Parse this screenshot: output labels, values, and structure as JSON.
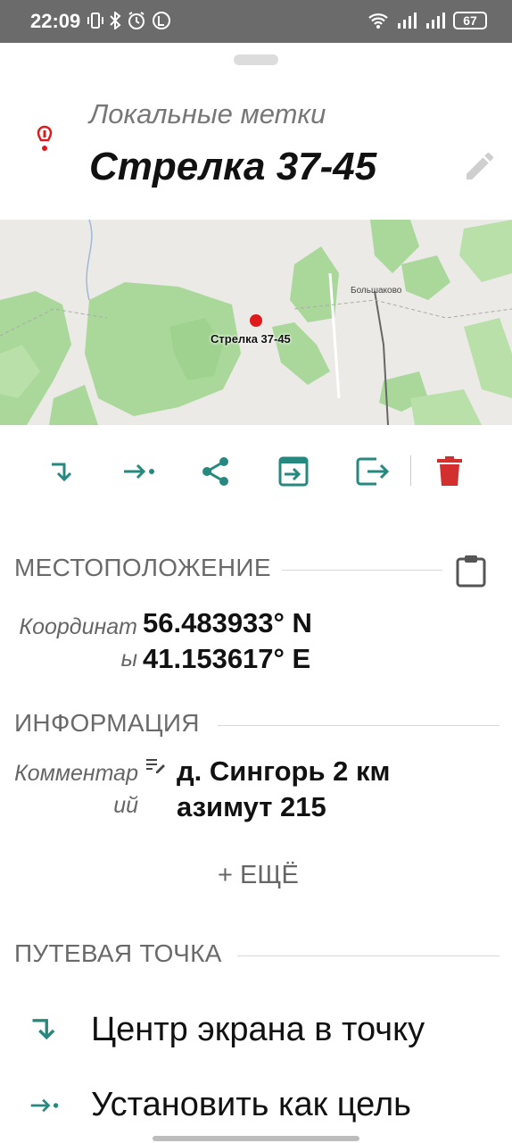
{
  "status_bar": {
    "time": "22:09",
    "battery": "67"
  },
  "header": {
    "category": "Локальные метки",
    "title": "Стрелка 37-45"
  },
  "map": {
    "marker_label": "Стрелка 37-45",
    "town_label": "Большаково"
  },
  "actions": [
    {
      "icon": "center-on-screen-icon"
    },
    {
      "icon": "set-destination-icon"
    },
    {
      "icon": "share-icon"
    },
    {
      "icon": "open-in-icon"
    },
    {
      "icon": "export-icon"
    },
    {
      "icon": "delete-icon",
      "color": "#d32f2f"
    }
  ],
  "location": {
    "section_title": "МЕСТОПОЛОЖЕНИЕ",
    "coords_label_line1": "Координат",
    "coords_label_line2": "ы",
    "lat": "56.483933° N",
    "lon": "41.153617° E"
  },
  "info": {
    "section_title": "ИНФОРМАЦИЯ",
    "comment_label_line1": "Комментар",
    "comment_label_line2": "ий",
    "comment_line1": "д. Сингорь 2 км",
    "comment_line2": "азимут 215",
    "more_button": "+ ЕЩЁ"
  },
  "waypoint": {
    "section_title": "ПУТЕВАЯ ТОЧКА",
    "items": [
      {
        "label": "Центр экрана в точку"
      },
      {
        "label": "Установить как цель"
      }
    ]
  },
  "colors": {
    "accent": "#26897f",
    "danger": "#d32f2f",
    "map_green": "#a9d89a",
    "marker": "#e0191a"
  }
}
